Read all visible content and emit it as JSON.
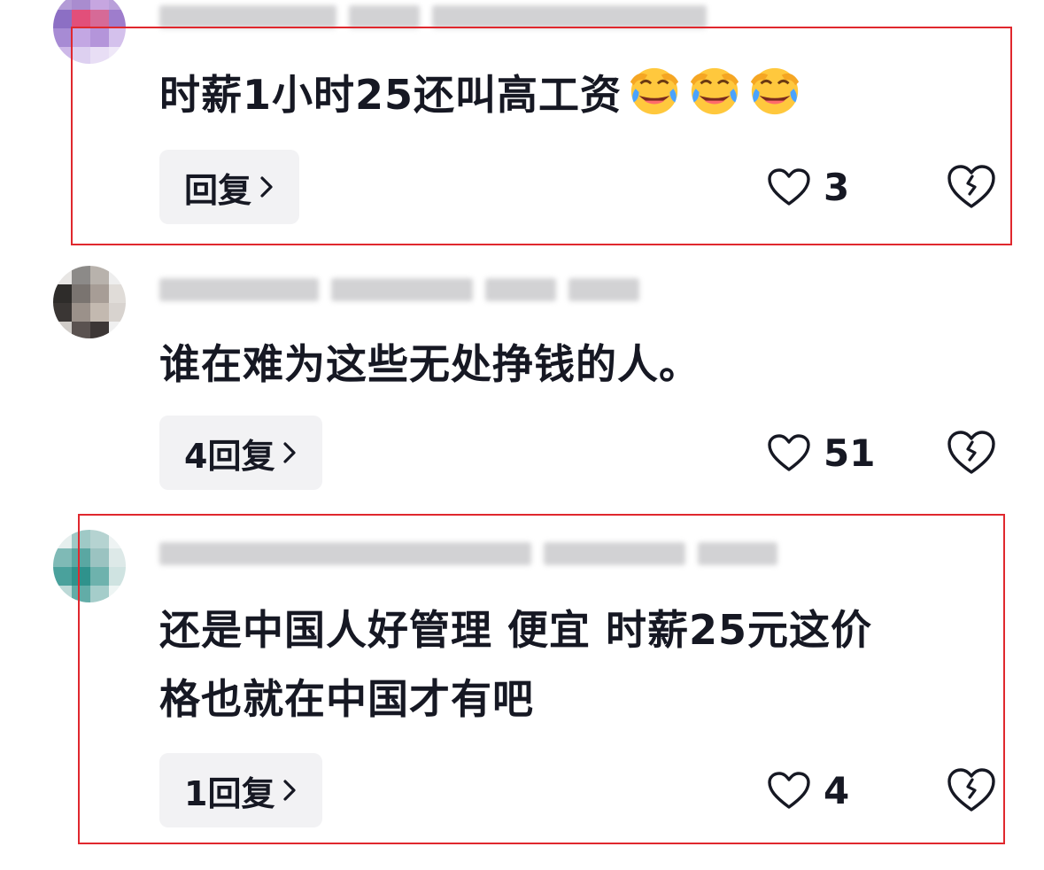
{
  "comments": [
    {
      "text_line1": "时薪1小时25还叫高工资",
      "text_line2": "",
      "reply_label": "回复",
      "like_count": "3",
      "emoji_count": 3,
      "highlighted": true
    },
    {
      "text_line1": "谁在难为这些无处挣钱的人。",
      "text_line2": "",
      "reply_label": "4回复",
      "like_count": "51",
      "emoji_count": 0,
      "highlighted": false
    },
    {
      "text_line1": "还是中国人好管理 便宜 时薪25元这价",
      "text_line2": "格也就在中国才有吧",
      "reply_label": "1回复",
      "like_count": "4",
      "emoji_count": 0,
      "highlighted": true
    }
  ],
  "icons": {
    "like": "heart-outline-icon",
    "dislike": "broken-heart-icon",
    "reply_chevron": "chevron-right-icon",
    "emoji": "laughing-crying-emoji"
  },
  "colors": {
    "text": "#161823",
    "reply_bg": "#f2f2f4",
    "highlight_border": "#e0282e"
  }
}
